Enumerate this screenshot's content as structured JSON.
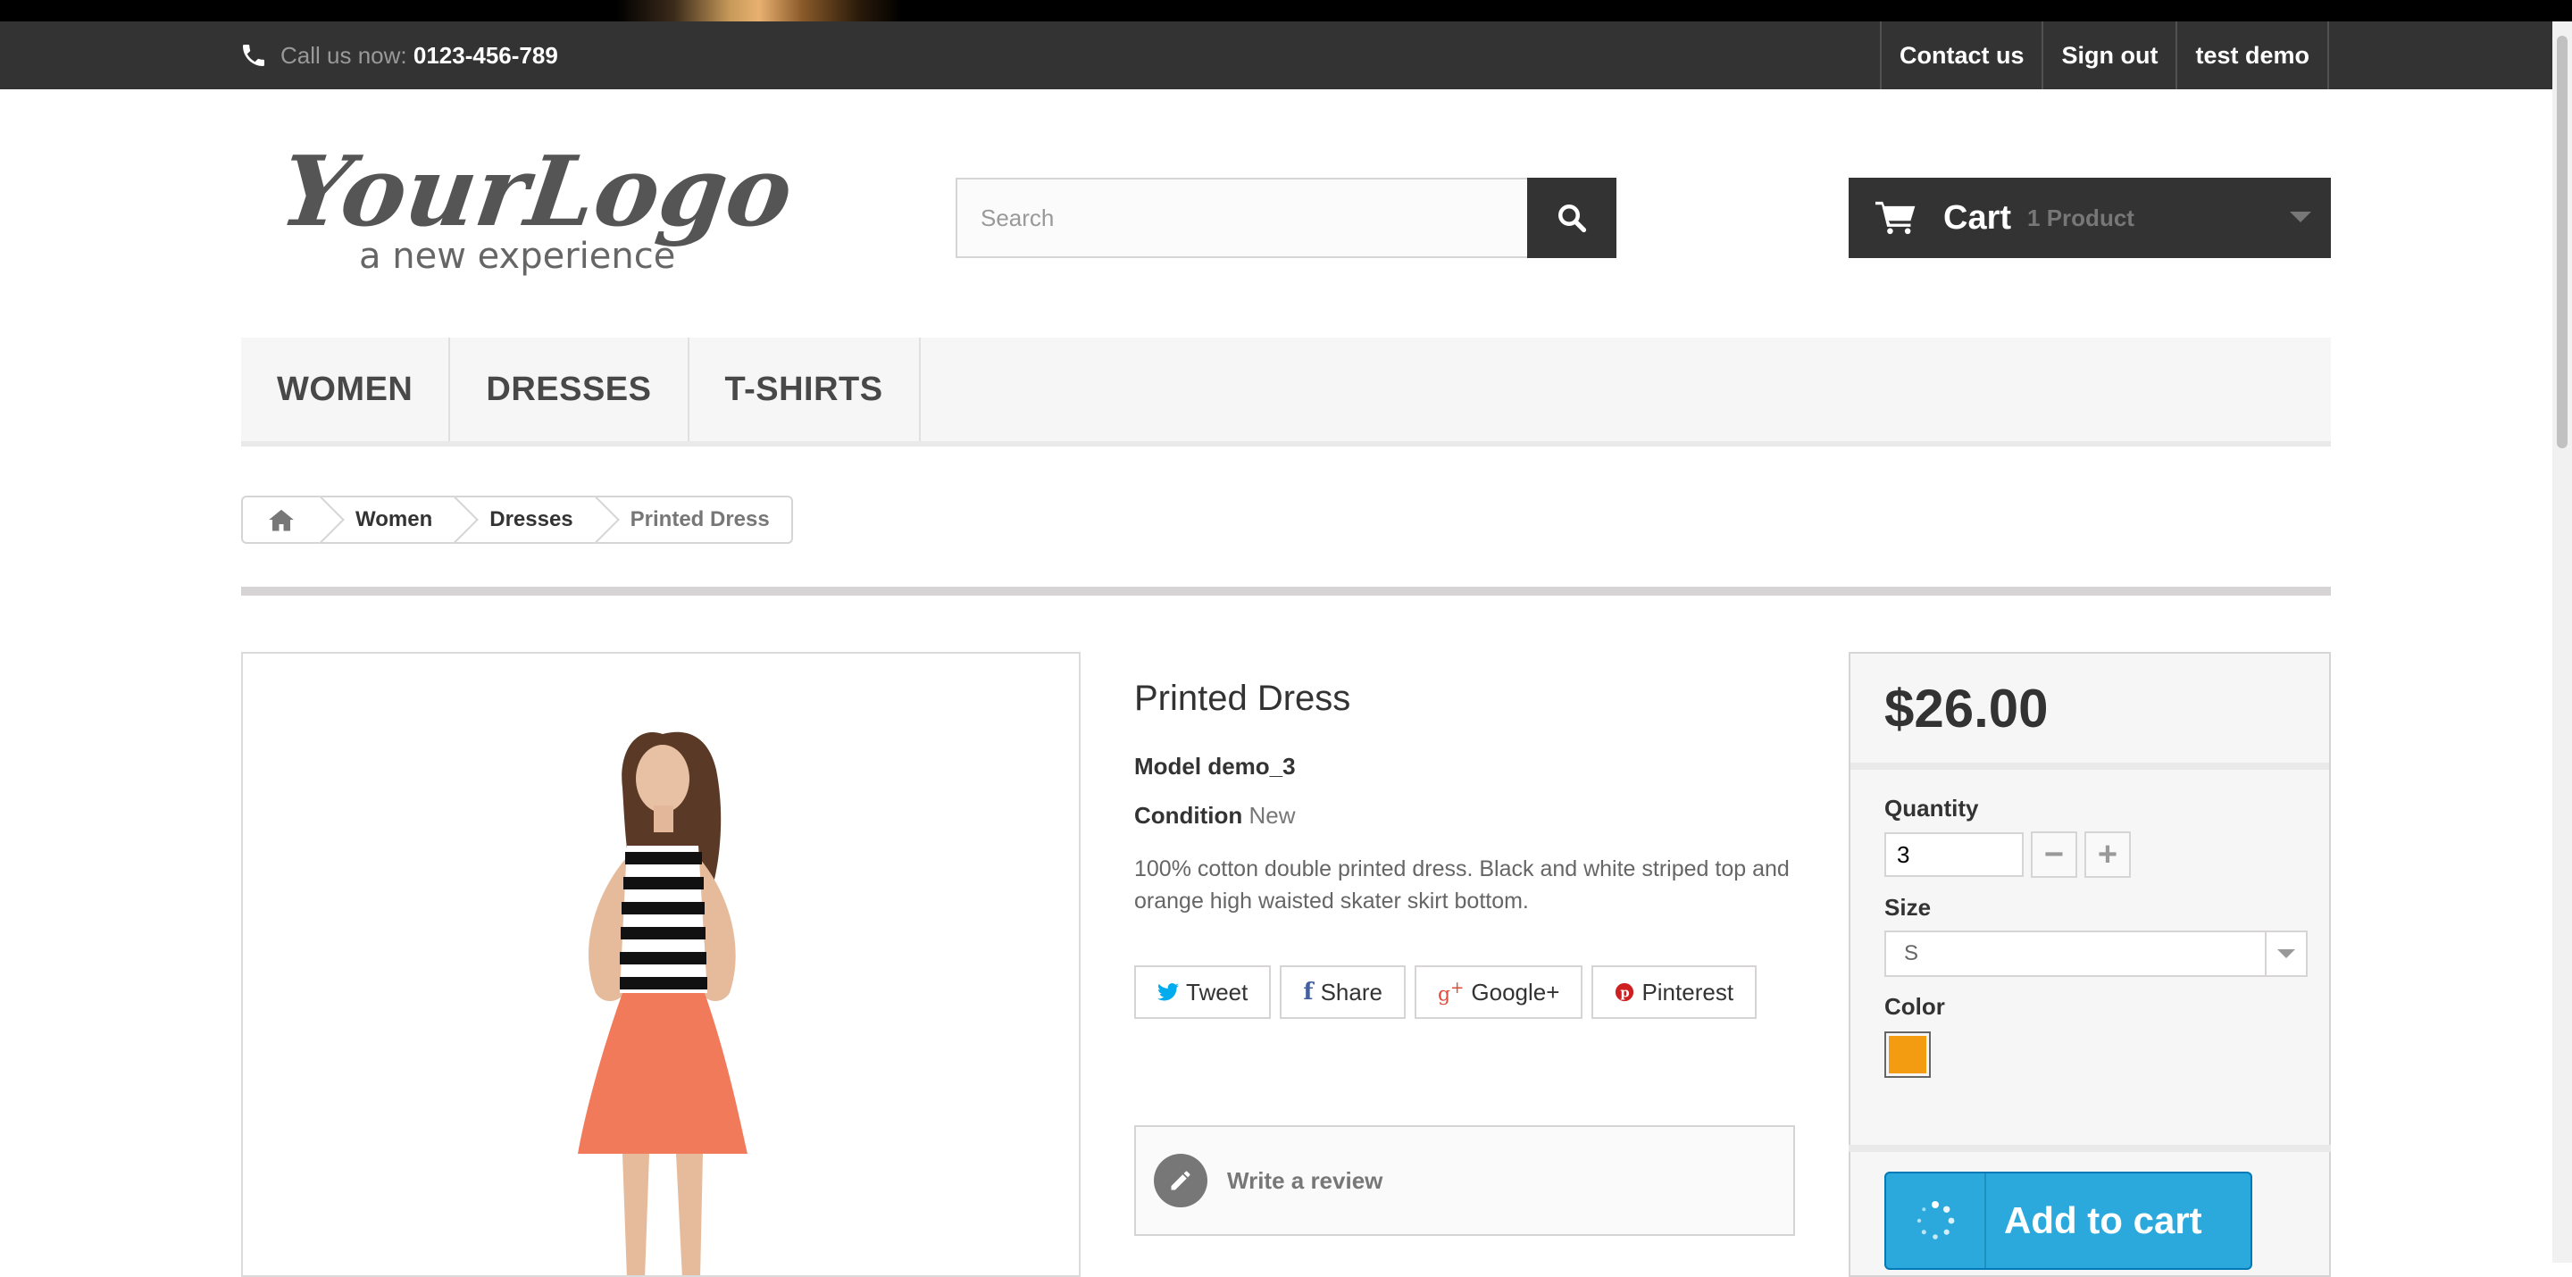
{
  "topbar": {
    "call_label": "Call us now:",
    "phone": "0123-456-789",
    "links": [
      "Contact us",
      "Sign out",
      "test demo"
    ]
  },
  "logo": {
    "title": "YourLogo",
    "tagline": "a new experience"
  },
  "search": {
    "placeholder": "Search",
    "icon": "search-icon"
  },
  "cart": {
    "label": "Cart",
    "count": "1 Product"
  },
  "menu": {
    "items": [
      "WOMEN",
      "DRESSES",
      "T-SHIRTS"
    ]
  },
  "breadcrumb": {
    "home_icon": "home-icon",
    "items": [
      "Women",
      "Dresses",
      "Printed Dress"
    ]
  },
  "product": {
    "name": "Printed Dress",
    "model_label": "Model",
    "model": "demo_3",
    "condition_label": "Condition",
    "condition": "New",
    "description": "100% cotton double printed dress. Black and white striped top and orange high waisted skater skirt bottom."
  },
  "social": {
    "tweet": "Tweet",
    "share": "Share",
    "google": "Google+",
    "pinterest": "Pinterest"
  },
  "review": {
    "label": "Write a review"
  },
  "buy": {
    "price": "$26.00",
    "quantity_label": "Quantity",
    "quantity": "3",
    "size_label": "Size",
    "size": "S",
    "color_label": "Color",
    "swatch_color": "#f39c11",
    "add_to_cart": "Add to cart"
  }
}
